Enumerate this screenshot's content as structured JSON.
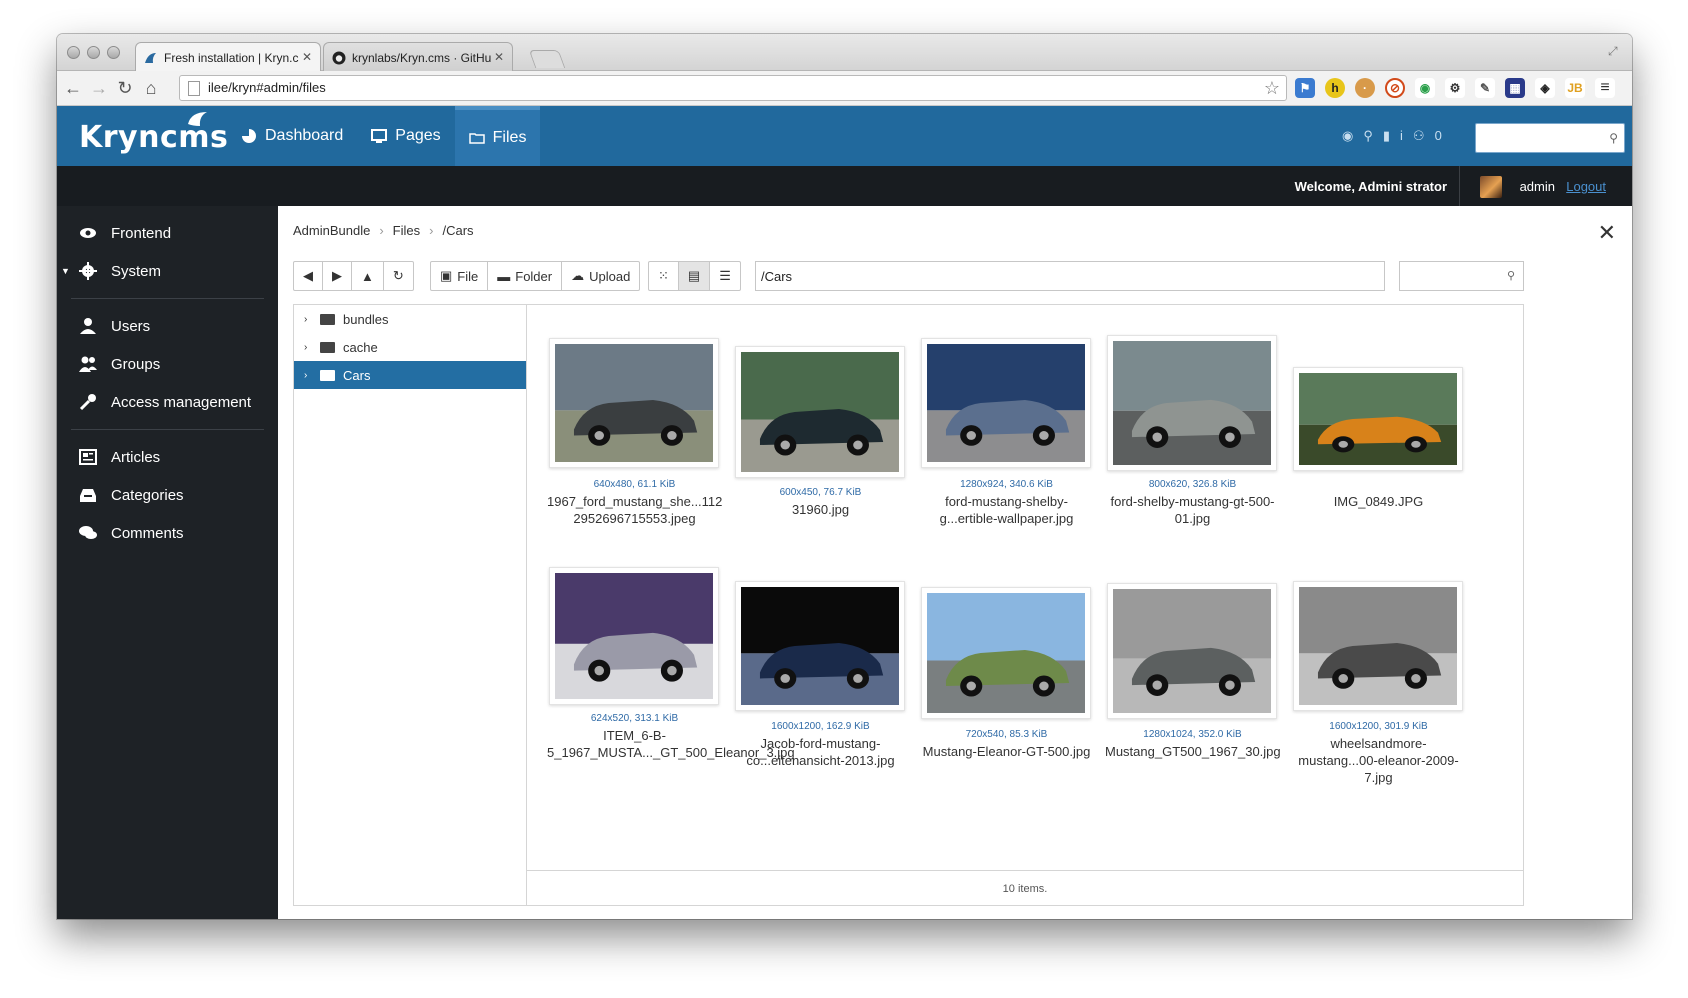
{
  "browser": {
    "tabs": [
      {
        "title": "Fresh installation | Kryn.c"
      },
      {
        "title": "krynlabs/Kryn.cms · GitHu"
      }
    ],
    "url": "ilee/kryn#admin/files"
  },
  "app": {
    "logo": "Kryncms",
    "nav": [
      {
        "label": "Dashboard",
        "icon": "dashboard-icon"
      },
      {
        "label": "Pages",
        "icon": "monitor-icon"
      },
      {
        "label": "Files",
        "icon": "folder-icon"
      }
    ],
    "tool_count": "0",
    "welcome": "Welcome, Admini strator",
    "username": "admin",
    "logout": "Logout"
  },
  "sidebar": {
    "items": [
      {
        "label": "Frontend",
        "icon": "eye-icon"
      },
      {
        "label": "System",
        "icon": "gear-icon"
      },
      {
        "label": "Users",
        "icon": "user-icon"
      },
      {
        "label": "Groups",
        "icon": "group-icon"
      },
      {
        "label": "Access management",
        "icon": "key-icon"
      },
      {
        "label": "Articles",
        "icon": "newspaper-icon"
      },
      {
        "label": "Categories",
        "icon": "inbox-icon"
      },
      {
        "label": "Comments",
        "icon": "comments-icon"
      }
    ]
  },
  "files": {
    "breadcrumb": [
      "AdminBundle",
      "Files",
      "/Cars"
    ],
    "toolbar": {
      "file": "File",
      "folder": "Folder",
      "upload": "Upload"
    },
    "path": "/Cars",
    "tree": [
      {
        "label": "bundles"
      },
      {
        "label": "cache"
      },
      {
        "label": "Cars"
      }
    ],
    "items": [
      {
        "meta": "640x480, 61.1 KiB",
        "name": "1967_ford_mustang_she...112 2952696715553.jpeg",
        "colors": [
          "#6c7a86",
          "#3a3e40",
          "#8a8f7a"
        ]
      },
      {
        "meta": "600x450, 76.7 KiB",
        "name": "31960.jpg",
        "colors": [
          "#4a6a4c",
          "#1e2a30",
          "#9a9a90"
        ]
      },
      {
        "meta": "1280x924, 340.6 KiB",
        "name": "ford-mustang-shelby-g...ertible-wallpaper.jpg",
        "colors": [
          "#25406c",
          "#5b6f8e",
          "#8d8d8f"
        ]
      },
      {
        "meta": "800x620, 326.8 KiB",
        "name": "ford-shelby-mustang-gt-500-01.jpg",
        "colors": [
          "#7b8a8e",
          "#8f9491",
          "#5c5f5f"
        ]
      },
      {
        "meta": "",
        "name": "IMG_0849.JPG",
        "colors": [
          "#5a7a5a",
          "#d8821a",
          "#3a4a2a"
        ]
      },
      {
        "meta": "624x520, 313.1 KiB",
        "name": "ITEM_6-B-5_1967_MUSTA..._GT_500_Eleanor_3.jpg",
        "colors": [
          "#4a3a6a",
          "#9a9aa8",
          "#d8d8dc"
        ]
      },
      {
        "meta": "1600x1200, 162.9 KiB",
        "name": "Jacob-ford-mustang-co...eitenansicht-2013.jpg",
        "colors": [
          "#0a0a0a",
          "#1a2a4a",
          "#5a6a8a"
        ]
      },
      {
        "meta": "720x540, 85.3 KiB",
        "name": "Mustang-Eleanor-GT-500.jpg",
        "colors": [
          "#8ab6e0",
          "#6e8a4a",
          "#7a7f80"
        ]
      },
      {
        "meta": "1280x1024, 352.0 KiB",
        "name": "Mustang_GT500_1967_30.jpg",
        "colors": [
          "#9a9a9a",
          "#5c6060",
          "#b8b8b8"
        ]
      },
      {
        "meta": "1600x1200, 301.9 KiB",
        "name": "wheelsandmore-mustang...00-eleanor-2009-7.jpg",
        "colors": [
          "#8a8a8a",
          "#4a4a4a",
          "#c0c0c0"
        ]
      }
    ],
    "status": "10 items."
  },
  "colors": {
    "brand": "#21699d",
    "sidebar": "#1e2226",
    "selected": "#236ea3",
    "link": "#2f6aa6"
  }
}
